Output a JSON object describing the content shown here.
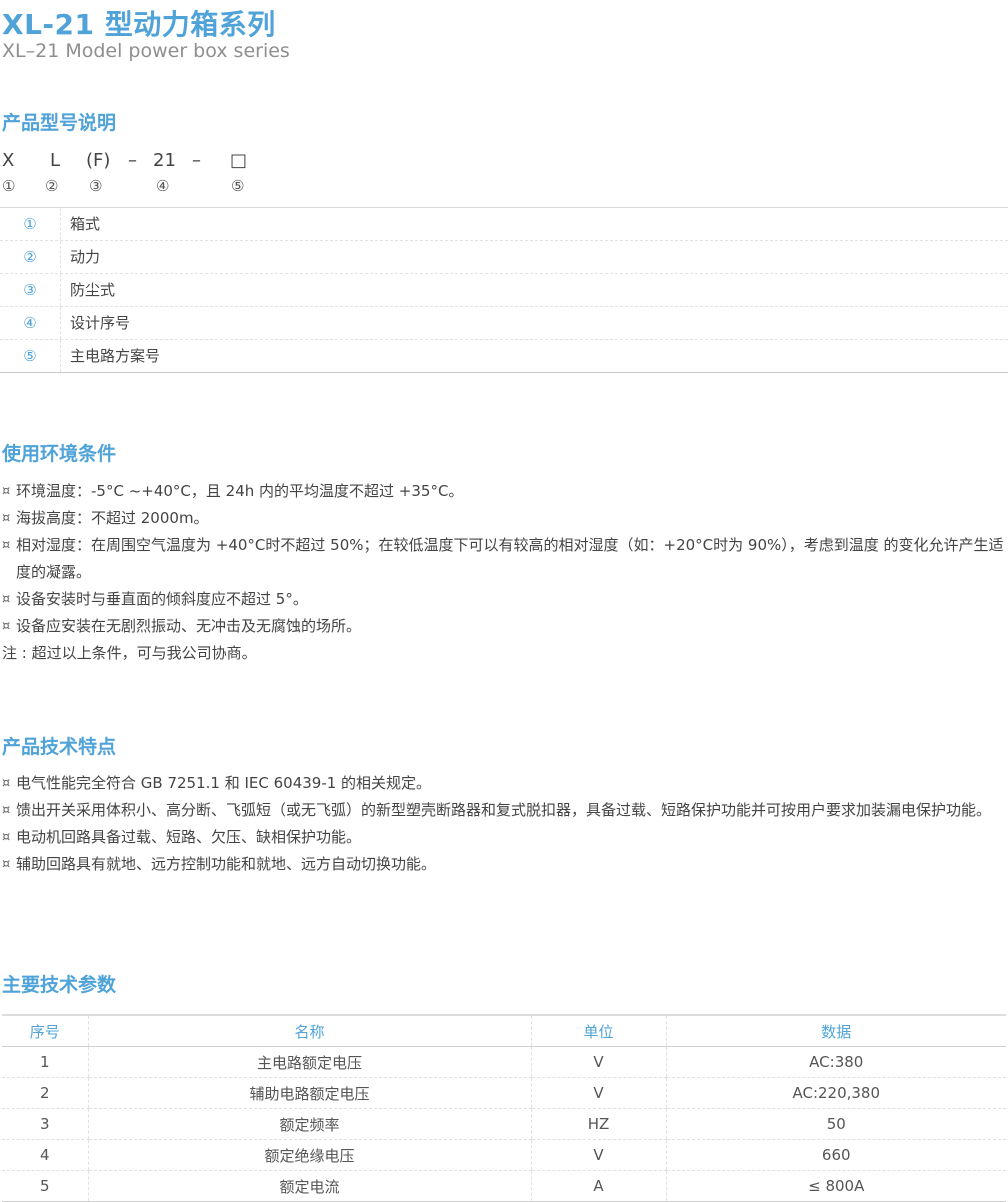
{
  "header": {
    "title": "XL-21 型动力箱系列",
    "subtitle": "XL–21 Model power box series"
  },
  "model_section": {
    "heading": "产品型号说明",
    "code": [
      "X",
      "L",
      "(F)",
      "–",
      "21",
      "–",
      "□"
    ],
    "markers": [
      "①",
      "②",
      "③",
      "④",
      "⑤"
    ],
    "items": [
      {
        "num": "①",
        "text": "箱式"
      },
      {
        "num": "②",
        "text": "动力"
      },
      {
        "num": "③",
        "text": "防尘式"
      },
      {
        "num": "④",
        "text": "设计序号"
      },
      {
        "num": "⑤",
        "text": "主电路方案号"
      }
    ]
  },
  "env_section": {
    "heading": "使用环境条件",
    "bullet": "¤",
    "lines": [
      "环境温度：-5°C ~+40°C，且 24h 内的平均温度不超过 +35°C。",
      "海拔高度：不超过 2000m。",
      "相对湿度：在周围空气温度为 +40°C时不超过 50%；在较低温度下可以有较高的相对湿度（如：+20°C时为 90%），考虑到温度 的变化允许产生适度的凝露。",
      "设备安装时与垂直面的倾斜度应不超过 5°。",
      "设备应安装在无剧烈振动、无冲击及无腐蚀的场所。"
    ],
    "note": "注 : 超过以上条件，可与我公司协商。"
  },
  "features_section": {
    "heading": "产品技术特点",
    "bullet": "¤",
    "lines": [
      "电气性能完全符合 GB 7251.1 和 IEC 60439-1 的相关规定。",
      "馈出开关采用体积小、高分断、飞弧短（或无飞弧）的新型塑壳断路器和复式脱扣器，具备过载、短路保护功能并可按用户要求加装漏电保护功能。",
      "电动机回路具备过载、短路、欠压、缺相保护功能。",
      "辅助回路具有就地、远方控制功能和就地、远方自动切换功能。"
    ]
  },
  "params_section": {
    "heading": "主要技术参数",
    "columns": [
      "序号",
      "名称",
      "单位",
      "数据"
    ],
    "rows": [
      [
        "1",
        "主电路额定电压",
        "V",
        "AC:380"
      ],
      [
        "2",
        "辅助电路额定电压",
        "V",
        "AC:220,380"
      ],
      [
        "3",
        "额定频率",
        "HZ",
        "50"
      ],
      [
        "4",
        "额定绝缘电压",
        "V",
        "660"
      ],
      [
        "5",
        "额定电流",
        "A",
        "≤ 800A"
      ]
    ]
  },
  "colors": {
    "accent": "#4fa3d9",
    "text": "#444444",
    "subtitle": "#8f8f8f"
  }
}
